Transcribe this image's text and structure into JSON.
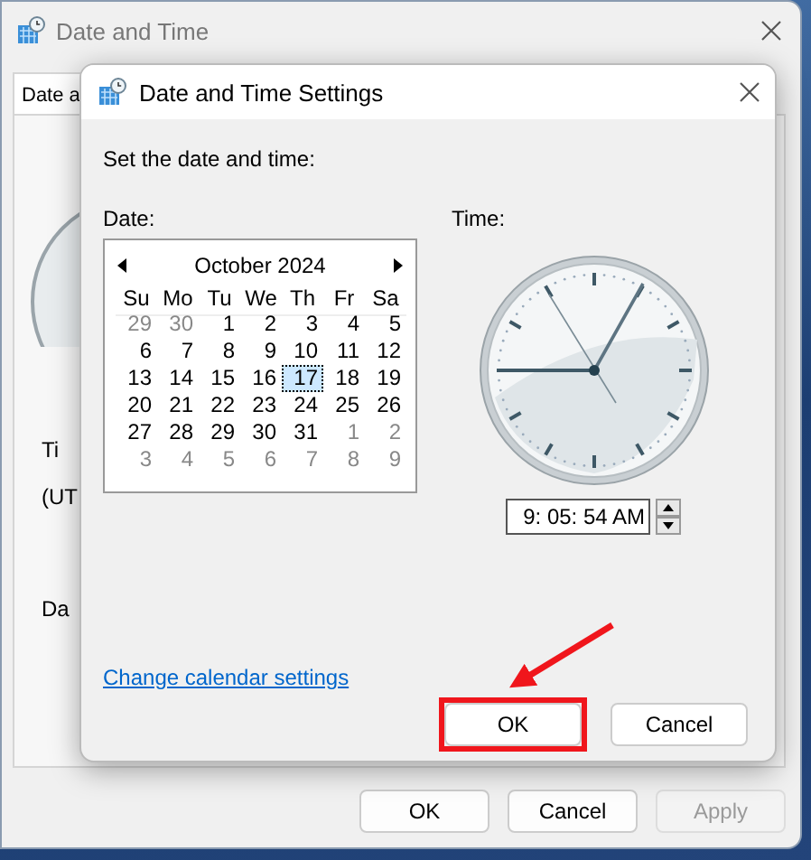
{
  "main_window": {
    "title": "Date and Time",
    "tab": "Date a",
    "labels": [
      "Ti",
      "(UT",
      "Da"
    ],
    "buttons": [
      {
        "label": "OK",
        "disabled": false
      },
      {
        "label": "Cancel",
        "disabled": false
      },
      {
        "label": "Apply",
        "disabled": true
      }
    ]
  },
  "dialog": {
    "title": "Date and Time Settings",
    "instruction": "Set the date and time:",
    "date_label": "Date:",
    "calendar": {
      "month": "October 2024",
      "weekdays": [
        "Su",
        "Mo",
        "Tu",
        "We",
        "Th",
        "Fr",
        "Sa"
      ],
      "days": [
        {
          "day": "29",
          "muted": true,
          "selected": false
        },
        {
          "day": "30",
          "muted": true,
          "selected": false
        },
        {
          "day": "1",
          "muted": false,
          "selected": false
        },
        {
          "day": "2",
          "muted": false,
          "selected": false
        },
        {
          "day": "3",
          "muted": false,
          "selected": false
        },
        {
          "day": "4",
          "muted": false,
          "selected": false
        },
        {
          "day": "5",
          "muted": false,
          "selected": false
        },
        {
          "day": "6",
          "muted": false,
          "selected": false
        },
        {
          "day": "7",
          "muted": false,
          "selected": false
        },
        {
          "day": "8",
          "muted": false,
          "selected": false
        },
        {
          "day": "9",
          "muted": false,
          "selected": false
        },
        {
          "day": "10",
          "muted": false,
          "selected": false
        },
        {
          "day": "11",
          "muted": false,
          "selected": false
        },
        {
          "day": "12",
          "muted": false,
          "selected": false
        },
        {
          "day": "13",
          "muted": false,
          "selected": false
        },
        {
          "day": "14",
          "muted": false,
          "selected": false
        },
        {
          "day": "15",
          "muted": false,
          "selected": false
        },
        {
          "day": "16",
          "muted": false,
          "selected": false
        },
        {
          "day": "17",
          "muted": false,
          "selected": true
        },
        {
          "day": "18",
          "muted": false,
          "selected": false
        },
        {
          "day": "19",
          "muted": false,
          "selected": false
        },
        {
          "day": "20",
          "muted": false,
          "selected": false
        },
        {
          "day": "21",
          "muted": false,
          "selected": false
        },
        {
          "day": "22",
          "muted": false,
          "selected": false
        },
        {
          "day": "23",
          "muted": false,
          "selected": false
        },
        {
          "day": "24",
          "muted": false,
          "selected": false
        },
        {
          "day": "25",
          "muted": false,
          "selected": false
        },
        {
          "day": "26",
          "muted": false,
          "selected": false
        },
        {
          "day": "27",
          "muted": false,
          "selected": false
        },
        {
          "day": "28",
          "muted": false,
          "selected": false
        },
        {
          "day": "29",
          "muted": false,
          "selected": false
        },
        {
          "day": "30",
          "muted": false,
          "selected": false
        },
        {
          "day": "31",
          "muted": false,
          "selected": false
        },
        {
          "day": "1",
          "muted": true,
          "selected": false
        },
        {
          "day": "2",
          "muted": true,
          "selected": false
        },
        {
          "day": "3",
          "muted": true,
          "selected": false
        },
        {
          "day": "4",
          "muted": true,
          "selected": false
        },
        {
          "day": "5",
          "muted": true,
          "selected": false
        },
        {
          "day": "6",
          "muted": true,
          "selected": false
        },
        {
          "day": "7",
          "muted": true,
          "selected": false
        },
        {
          "day": "8",
          "muted": true,
          "selected": false
        },
        {
          "day": "9",
          "muted": true,
          "selected": false
        }
      ]
    },
    "time_label": "Time:",
    "time": {
      "value": "9: 05: 54 AM"
    },
    "link": "Change calendar settings",
    "buttons": [
      {
        "label": "OK",
        "highlighted": true
      },
      {
        "label": "Cancel",
        "highlighted": false
      }
    ]
  }
}
